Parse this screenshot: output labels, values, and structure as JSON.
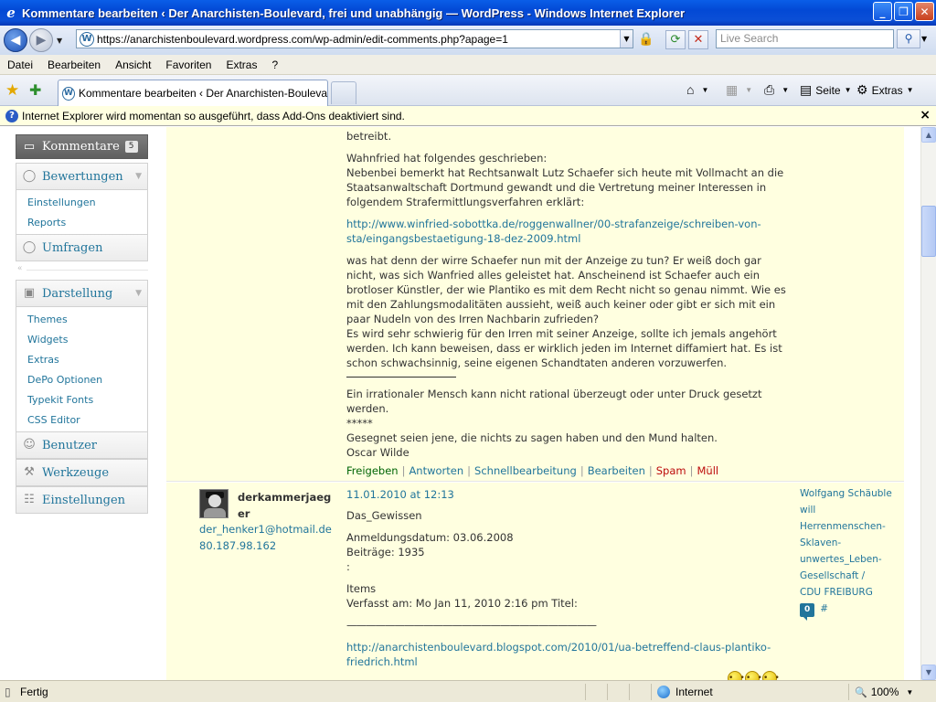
{
  "window": {
    "title": "Kommentare bearbeiten ‹ Der Anarchisten-Boulevard, frei und unabhängig — WordPress - Windows Internet Explorer",
    "minimize": "_",
    "maximize": "❐",
    "close": "✕"
  },
  "address": {
    "url": "https://anarchistenboulevard.wordpress.com/wp-admin/edit-comments.php?apage=1",
    "search_placeholder": "Live Search"
  },
  "menubar": [
    "Datei",
    "Bearbeiten",
    "Ansicht",
    "Favoriten",
    "Extras",
    "?"
  ],
  "tab": {
    "label": "Kommentare bearbeiten ‹ Der Anarchisten-Boulevard,..."
  },
  "commandbar": {
    "page": "Seite",
    "tools": "Extras"
  },
  "infobar": {
    "text": "Internet Explorer wird momentan so ausgeführt, dass Add-Ons deaktiviert sind.",
    "close": "×"
  },
  "sidebar": {
    "comments": {
      "label": "Kommentare",
      "count": "5"
    },
    "ratings": {
      "label": "Bewertungen",
      "items": [
        "Einstellungen",
        "Reports"
      ]
    },
    "polls": {
      "label": "Umfragen"
    },
    "appearance": {
      "label": "Darstellung",
      "items": [
        "Themes",
        "Widgets",
        "Extras",
        "DePo Optionen",
        "Typekit Fonts",
        "CSS Editor"
      ]
    },
    "users": {
      "label": "Benutzer"
    },
    "tools": {
      "label": "Werkzeuge"
    },
    "settings": {
      "label": "Einstellungen"
    }
  },
  "comment1": {
    "lines": [
      "betreibt.",
      "",
      "Wahnfried hat folgendes geschrieben:",
      "Nebenbei bemerkt hat Rechtsanwalt Lutz Schaefer sich heute mit Vollmacht an die",
      "Staatsanwaltschaft Dortmund gewandt und die Vertretung meiner Interessen in",
      "folgendem Strafermittlungsverfahren erklärt:"
    ],
    "link_line1": "http://www.winfried-sobottka.de/roggenwallner/00-strafanzeige/schreiben-von-",
    "link_line2": "sta/eingangsbestaetigung-18-dez-2009.html",
    "para2": [
      "was hat denn der wirre Schaefer nun mit der Anzeige zu tun? Er weiß doch gar",
      "nicht, was sich Wanfried alles geleistet hat. Anscheinend ist Schaefer auch ein",
      "brotloser Künstler, der wie Plantiko es mit dem Recht nicht so genau nimmt. Wie es",
      "mit den Zahlungsmodalitäten aussieht, weiß auch keiner oder gibt er sich mit ein",
      "paar Nudeln von des Irren Nachbarin zufrieden?",
      "Es wird sehr schwierig für den Irren mit seiner Anzeige, sollte ich jemals angehört",
      "werden. Ich kann beweisen, dass er wirklich jeden im Internet diffamiert hat. Es ist",
      "schon schwachsinnig, seine eigenen Schandtaten anderen vorzuwerfen."
    ],
    "para3": [
      "Ein irrationaler Mensch kann nicht rational überzeugt oder unter Druck gesetzt",
      "werden.",
      "*****",
      "Gesegnet seien jene, die nichts zu sagen haben und den Mund halten.",
      "Oscar Wilde"
    ],
    "actions": {
      "approve": "Freigeben",
      "reply": "Antworten",
      "quickedit": "Schnellbearbeitung",
      "edit": "Bearbeiten",
      "spam": "Spam",
      "trash": "Müll",
      "separator": "|"
    }
  },
  "comment2": {
    "author_line1": "derkammerjaeg",
    "author_line2": "er",
    "email": "der_henker1@hotmail.de",
    "ip": "80.187.98.162",
    "date": "11.01.2010 at 12:13",
    "lines": [
      "Das_Gewissen",
      "",
      "Anmeldungsdatum: 03.06.2008",
      "Beiträge: 1935",
      ":",
      "",
      "Items",
      "Verfasst am: Mo Jan 11, 2010 2:16 pm Titel:",
      "",
      "——————————————————————————"
    ],
    "link_line1": "http://anarchistenboulevard.blogspot.com/2010/01/ua-betreffend-claus-plantiko-",
    "link_line2": "friedrich.html",
    "response_lines": [
      "Wolfgang Schäuble",
      "will Herrenmenschen-",
      "Sklaven-",
      "unwertes_Leben-",
      "Gesellschaft /",
      "CDU FREIBURG"
    ],
    "response_count": "0",
    "response_hash": "#"
  },
  "statusbar": {
    "status": "Fertig",
    "zone": "Internet",
    "zoom": "100%"
  }
}
